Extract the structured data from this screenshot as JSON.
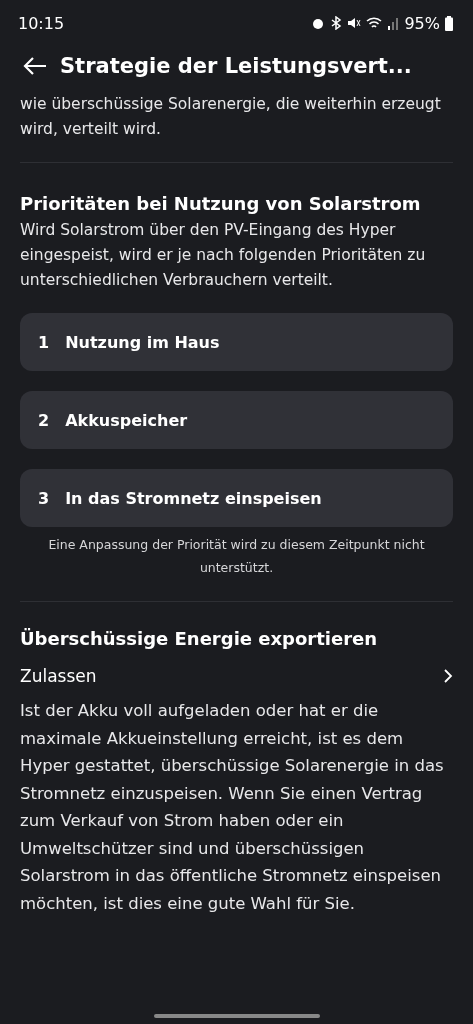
{
  "status_bar": {
    "time": "10:15",
    "battery": "95%"
  },
  "header": {
    "title": "Strategie der Leistungsvert..."
  },
  "intro": "wie überschüssige Solarenergie, die weiterhin erzeugt wird, verteilt wird.",
  "priorities": {
    "title": "Prioritäten bei Nutzung von Solarstrom",
    "description": "Wird Solarstrom über den PV-Eingang des Hyper eingespeist, wird er je nach folgenden Prioritäten zu unterschiedlichen Verbrauchern verteilt.",
    "items": [
      {
        "number": "1",
        "label": "Nutzung im Haus"
      },
      {
        "number": "2",
        "label": "Akkuspeicher"
      },
      {
        "number": "3",
        "label": "In das Stromnetz einspeisen"
      }
    ],
    "note": "Eine Anpassung der Priorität wird zu diesem Zeitpunkt nicht unterstützt."
  },
  "export": {
    "title": "Überschüssige Energie exportieren",
    "setting": "Zulassen",
    "description": "Ist der Akku voll aufgeladen oder hat er die maximale Akkueinstellung erreicht, ist es dem Hyper gestattet, überschüssige Solarenergie in das Stromnetz einzuspeisen. Wenn Sie einen Vertrag zum Verkauf von Strom haben oder ein Umweltschützer sind und überschüssigen Solarstrom in das öffentliche Stromnetz einspeisen möchten, ist dies eine gute Wahl für Sie."
  }
}
